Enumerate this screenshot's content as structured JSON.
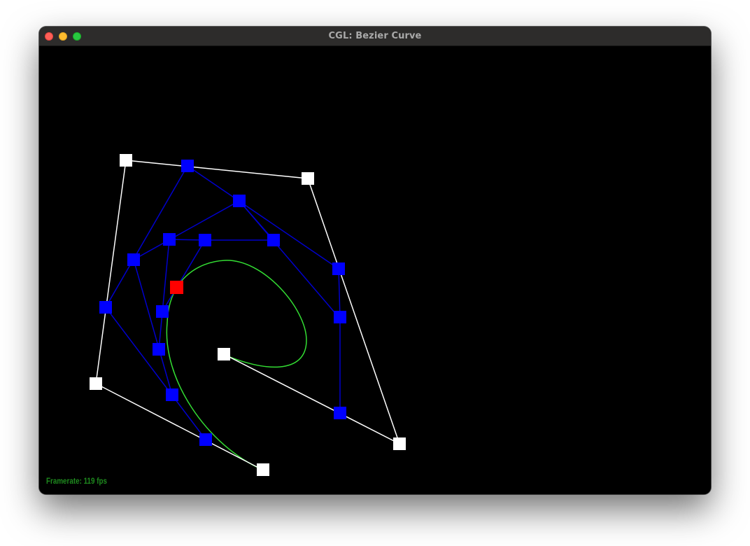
{
  "window": {
    "title": "CGL: Bezier Curve",
    "controls": [
      "close-button",
      "minimize-button",
      "zoom-button"
    ]
  },
  "status": {
    "framerate_label": "Framerate: 119 fps"
  },
  "colors": {
    "background": "#000000",
    "control_polygon": "#ffffff",
    "intermediate_points": "#0000ff",
    "evaluated_point": "#ff0000",
    "curve": "#33dd33",
    "status_text": "#1e8a1e"
  }
}
